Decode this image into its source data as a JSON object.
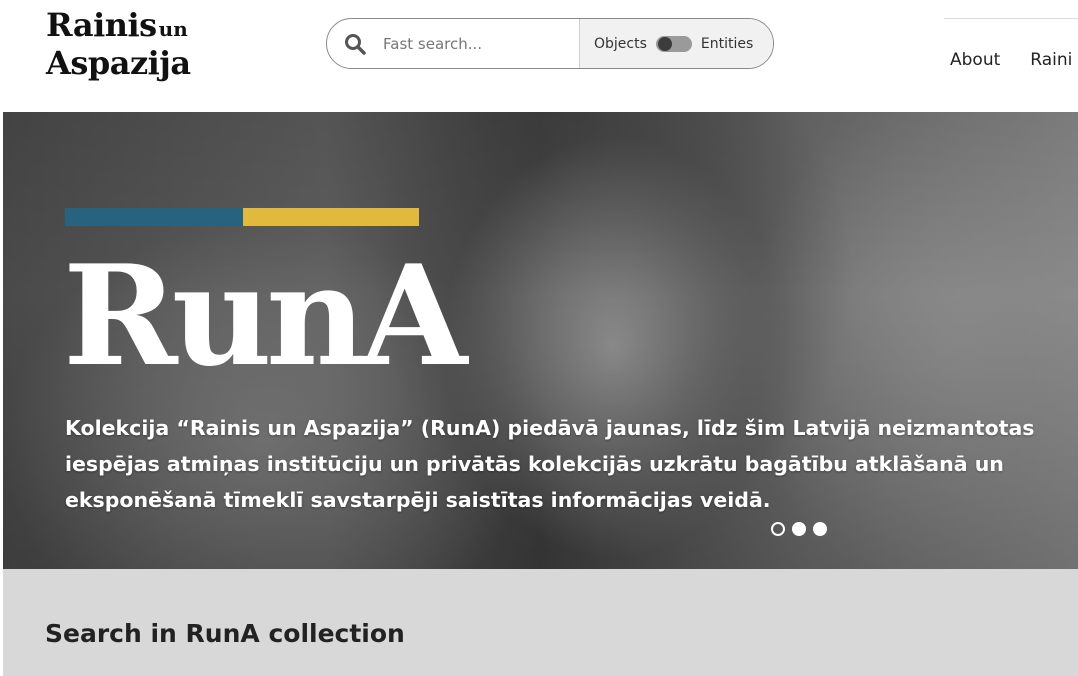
{
  "header": {
    "logo": {
      "line1": "Rainis",
      "line1_small": "un",
      "line2": "Aspazija"
    },
    "search": {
      "placeholder": "Fast search...",
      "value": "",
      "toggle_left_label": "Objects",
      "toggle_right_label": "Entities",
      "toggle_state": "Objects"
    },
    "nav": {
      "items": [
        {
          "label": "About"
        },
        {
          "label": "Raini"
        }
      ]
    }
  },
  "hero": {
    "title": "RunA",
    "description": "Kolekcija “Rainis un Aspazija” (RunA)  piedāvā jaunas, līdz šim Latvijā neizmantotas iespējas atmiņas institūciju un privātās kolekcijās uzkrātu bagātību atklāšanā un eksponēšanā tīmeklī savstarpēji saistītas informācijas veidā.",
    "accent_colors": {
      "blue": "#27627f",
      "yellow": "#e1b93d"
    },
    "carousel": {
      "slide_count": 3,
      "active_slide": 1
    }
  },
  "section": {
    "title": "Search in RunA collection"
  },
  "icons": {
    "search": "search-icon"
  }
}
